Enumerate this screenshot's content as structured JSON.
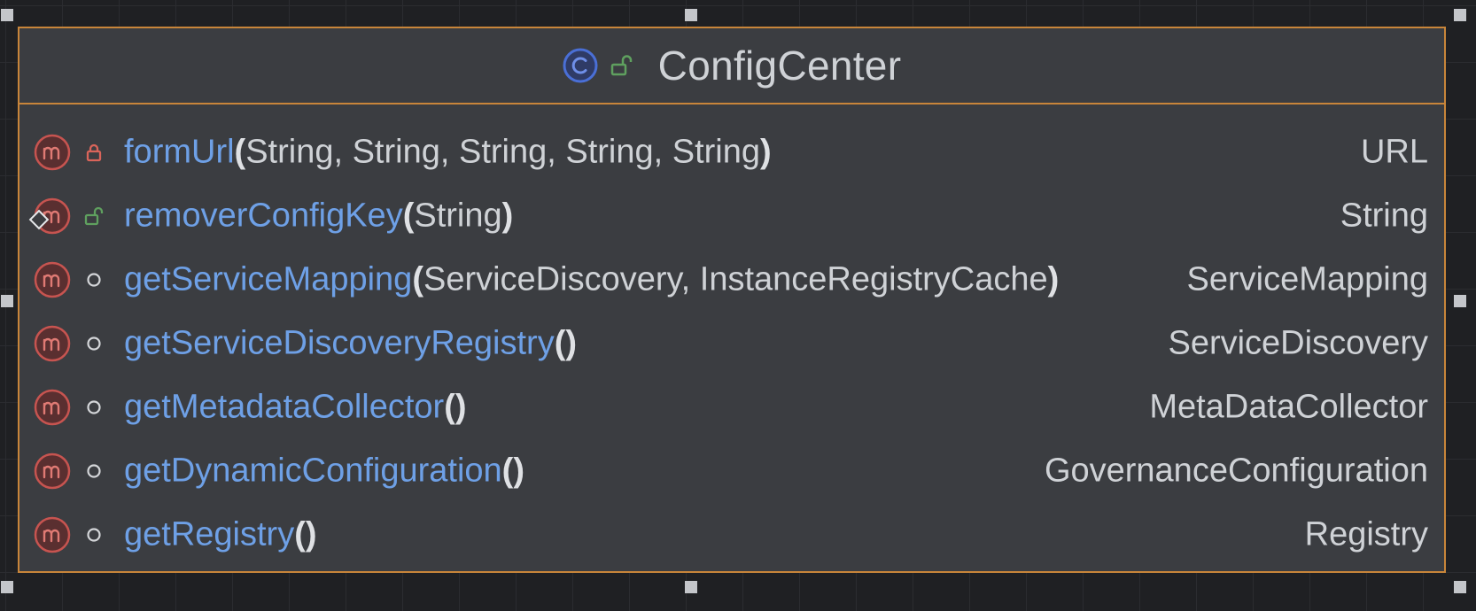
{
  "class": {
    "name": "ConfigCenter",
    "icon": "class-icon",
    "visibility_icon": "open-lock-icon"
  },
  "methods": [
    {
      "name": "formUrl",
      "params": "String, String, String, String, String",
      "return_type": "URL",
      "visibility": "private"
    },
    {
      "name": "removerConfigKey",
      "params": "String",
      "return_type": "String",
      "visibility": "public"
    },
    {
      "name": "getServiceMapping",
      "params": "ServiceDiscovery, InstanceRegistryCache",
      "return_type": "ServiceMapping",
      "visibility": "package"
    },
    {
      "name": "getServiceDiscoveryRegistry",
      "params": "",
      "return_type": "ServiceDiscovery",
      "visibility": "package"
    },
    {
      "name": "getMetadataCollector",
      "params": "",
      "return_type": "MetaDataCollector",
      "visibility": "package"
    },
    {
      "name": "getDynamicConfiguration",
      "params": "",
      "return_type": "GovernanceConfiguration",
      "visibility": "package"
    },
    {
      "name": "getRegistry",
      "params": "",
      "return_type": "Registry",
      "visibility": "package"
    }
  ],
  "colors": {
    "border": "#c8853a",
    "method_name": "#6ea0e6",
    "method_icon": "#c75450",
    "class_icon": "#4a6fd6",
    "public_lock": "#5fa05f",
    "private_lock": "#d9645a"
  }
}
